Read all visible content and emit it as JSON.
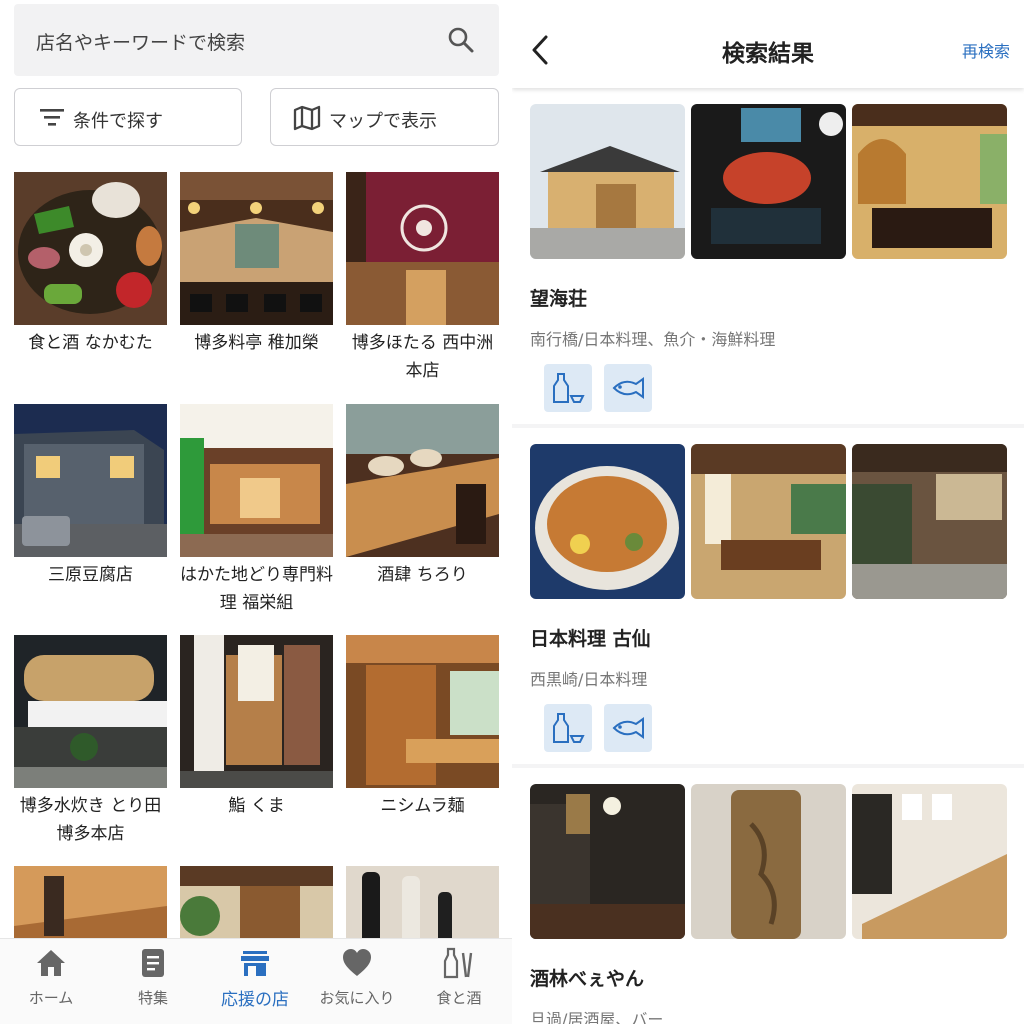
{
  "left": {
    "search": {
      "placeholder": "店名やキーワードで検索"
    },
    "filter_button": "条件で探す",
    "map_button": "マップで表示",
    "grid": [
      {
        "name": "食と酒 なかむた"
      },
      {
        "name": "博多料亭 稚加榮"
      },
      {
        "name": "博多ほたる 西中洲本店"
      },
      {
        "name": "三原豆腐店"
      },
      {
        "name": "はかた地どり専門料理 福栄組"
      },
      {
        "name": "酒肆 ちろり"
      },
      {
        "name": "博多水炊き とり田 博多本店"
      },
      {
        "name": "鮨 くま"
      },
      {
        "name": "ニシムラ麺"
      },
      {
        "name": ""
      },
      {
        "name": ""
      },
      {
        "name": ""
      }
    ],
    "nav": [
      {
        "label": "ホーム",
        "icon": "home-icon"
      },
      {
        "label": "特集",
        "icon": "document-icon"
      },
      {
        "label": "応援の店",
        "icon": "store-icon"
      },
      {
        "label": "お気に入り",
        "icon": "heart-icon"
      },
      {
        "label": "食と酒",
        "icon": "sake-icon"
      }
    ],
    "accent_color": "#2a6fc0"
  },
  "right": {
    "header": {
      "title": "検索結果",
      "research_label": "再検索"
    },
    "results": [
      {
        "name": "望海荘",
        "area": "南行橋/日本料理、魚介・海鮮料理",
        "tags": [
          "sake-icon",
          "fish-icon"
        ]
      },
      {
        "name": "日本料理 古仙",
        "area": "西黒崎/日本料理",
        "tags": [
          "sake-icon",
          "fish-icon"
        ]
      },
      {
        "name": "酒林べぇやん",
        "area": "旦過/居酒屋、バー",
        "tags": []
      }
    ]
  }
}
